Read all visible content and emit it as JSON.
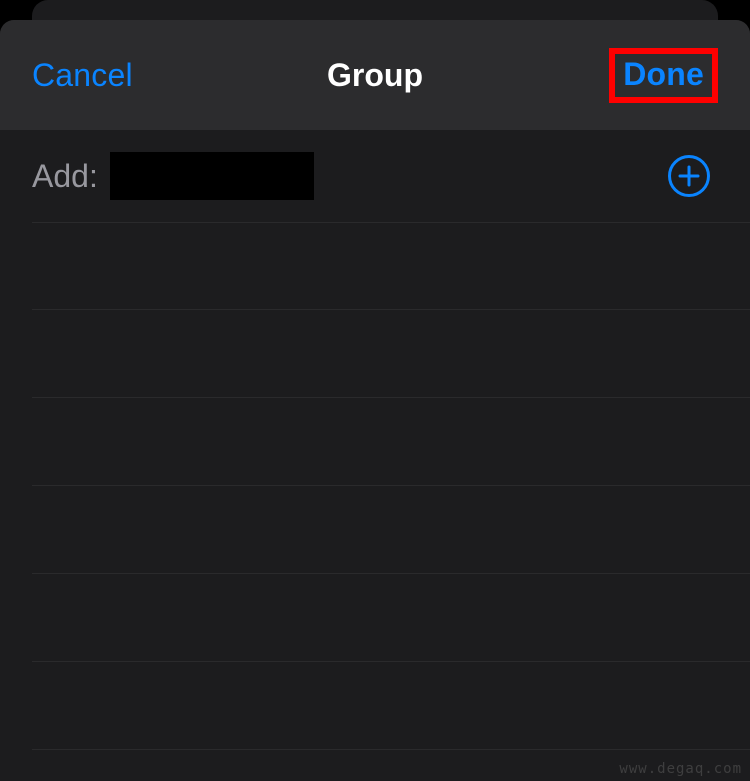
{
  "nav": {
    "cancel_label": "Cancel",
    "title": "Group",
    "done_label": "Done"
  },
  "add_section": {
    "label": "Add:",
    "input_value": ""
  },
  "list": {
    "rows": [
      "",
      "",
      "",
      "",
      "",
      ""
    ]
  },
  "watermark": "www.degaq.com",
  "colors": {
    "accent": "#0a84ff",
    "highlight_box": "#ff0000"
  }
}
